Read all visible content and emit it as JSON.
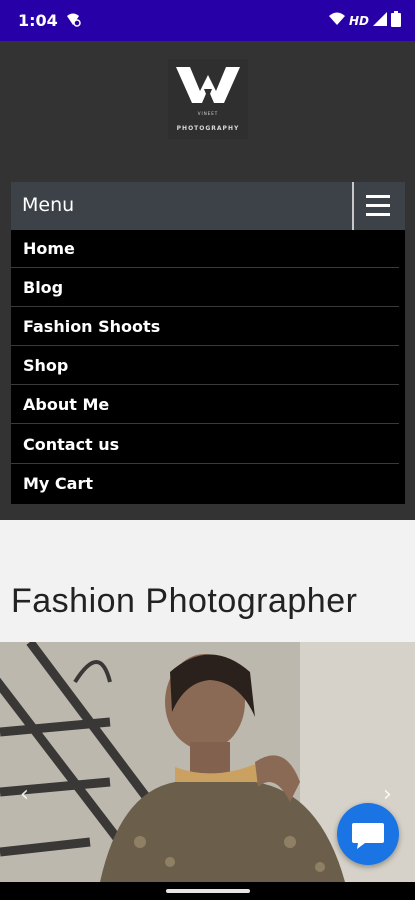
{
  "status_bar": {
    "time": "1:04",
    "network": "HD",
    "icons": [
      "notification-icon",
      "wifi-icon",
      "signal-icon",
      "battery-icon"
    ]
  },
  "logo": {
    "line1": "VINEET",
    "line2": "PHOTOGRAPHY"
  },
  "menu": {
    "label": "Menu",
    "items": [
      {
        "label": "Home"
      },
      {
        "label": "Blog"
      },
      {
        "label": "Fashion Shoots"
      },
      {
        "label": "Shop"
      },
      {
        "label": "About Me"
      },
      {
        "label": "Contact us"
      },
      {
        "label": "My Cart"
      }
    ]
  },
  "main": {
    "heading": "Fashion Photographer"
  },
  "carousel": {
    "prev_icon": "chevron-left-icon",
    "next_icon": "chevron-right-icon",
    "prev_glyph": "‹",
    "next_glyph": "›"
  },
  "colors": {
    "status_bar": "#2800a8",
    "header_bg": "#333333",
    "menu_bar": "#3d4148",
    "nav_bg": "#000000",
    "chat_button": "#1b74e4"
  }
}
